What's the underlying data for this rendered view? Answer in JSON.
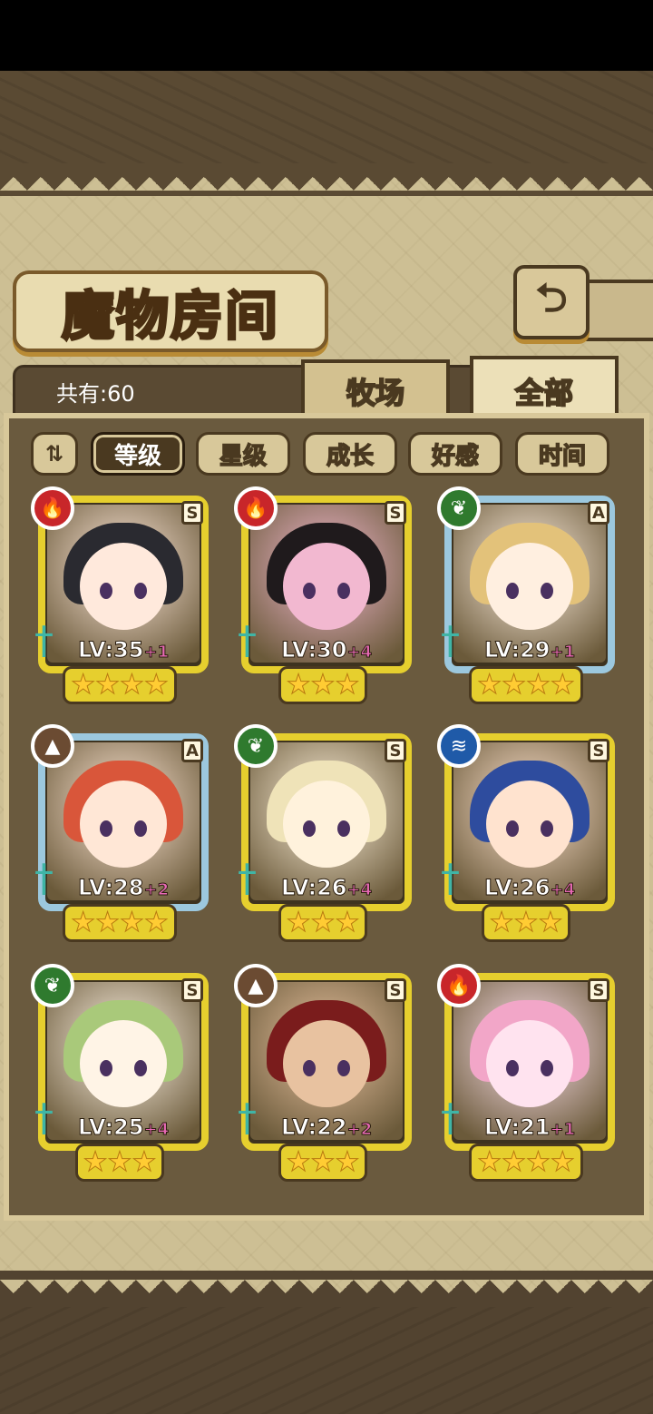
{
  "screen": {
    "title": "魔物房间",
    "back_icon": "return-icon"
  },
  "count_label": "共有:60",
  "tabs": [
    {
      "label": "牧场"
    },
    {
      "label": "全部"
    }
  ],
  "sort": {
    "toggle_icon": "sort-order-icon",
    "buttons": [
      "等级",
      "星级",
      "成长",
      "好感",
      "时间"
    ],
    "active": "等级"
  },
  "monsters": [
    {
      "element": "fire",
      "rank": "S",
      "level": "LV:35",
      "plus": "+1",
      "stars": 4
    },
    {
      "element": "fire",
      "rank": "S",
      "level": "LV:30",
      "plus": "+4",
      "stars": 3
    },
    {
      "element": "grass",
      "rank": "A",
      "level": "LV:29",
      "plus": "+1",
      "stars": 4
    },
    {
      "element": "earth",
      "rank": "A",
      "level": "LV:28",
      "plus": "+2",
      "stars": 4
    },
    {
      "element": "grass",
      "rank": "S",
      "level": "LV:26",
      "plus": "+4",
      "stars": 3
    },
    {
      "element": "water",
      "rank": "S",
      "level": "LV:26",
      "plus": "+4",
      "stars": 3
    },
    {
      "element": "grass",
      "rank": "S",
      "level": "LV:25",
      "plus": "+4",
      "stars": 3
    },
    {
      "element": "earth",
      "rank": "S",
      "level": "LV:22",
      "plus": "+2",
      "stars": 3
    },
    {
      "element": "fire",
      "rank": "S",
      "level": "LV:21",
      "plus": "+1",
      "stars": 4
    }
  ]
}
